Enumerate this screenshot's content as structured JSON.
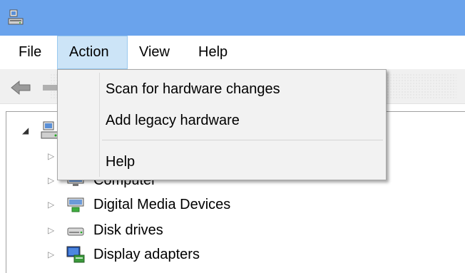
{
  "menubar": {
    "file": "File",
    "action": "Action",
    "view": "View",
    "help": "Help"
  },
  "action_menu": {
    "items": [
      {
        "label": "Scan for hardware changes"
      },
      {
        "label": "Add legacy hardware"
      },
      {
        "label": "Help"
      }
    ]
  },
  "tree": {
    "items": [
      {
        "label": "Computer",
        "icon": "computer-icon"
      },
      {
        "label": "Digital Media Devices",
        "icon": "media-device-icon"
      },
      {
        "label": "Disk drives",
        "icon": "disk-drive-icon"
      },
      {
        "label": "Display adapters",
        "icon": "display-adapter-icon"
      }
    ]
  },
  "colors": {
    "titlebar": "#6aa3ec",
    "menu_active": "#cce4f7",
    "dropdown_bg": "#f2f2f2"
  }
}
